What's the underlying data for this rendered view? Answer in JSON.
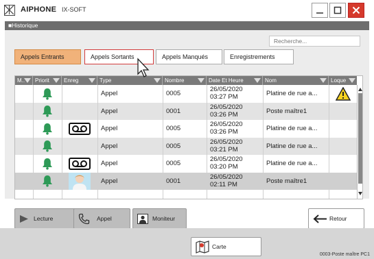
{
  "app": {
    "brand": "AIPHONE",
    "product": "IX-SOFT"
  },
  "section_title": "■Historique",
  "search": {
    "placeholder": "Recherche..."
  },
  "tabs": [
    {
      "label": "Appels Entrants"
    },
    {
      "label": "Appels Sortants"
    },
    {
      "label": "Appels Manqués"
    },
    {
      "label": "Enregistrements"
    }
  ],
  "columns": [
    "M..",
    "Priorit",
    "Enreg",
    "Type",
    "Nombre",
    "Date Et Heure",
    "Nom",
    "Loque"
  ],
  "rows": [
    {
      "rec": false,
      "photo": false,
      "type": "Appel",
      "number": "0005",
      "date": "26/05/2020",
      "time": "03:27 PM",
      "name": "Platine de rue a...",
      "lock": true
    },
    {
      "rec": false,
      "photo": false,
      "type": "Appel",
      "number": "0001",
      "date": "26/05/2020",
      "time": "03:26 PM",
      "name": "Poste maître1",
      "lock": false
    },
    {
      "rec": true,
      "photo": false,
      "type": "Appel",
      "number": "0005",
      "date": "26/05/2020",
      "time": "03:26 PM",
      "name": "Platine de rue a...",
      "lock": false
    },
    {
      "rec": false,
      "photo": false,
      "type": "Appel",
      "number": "0005",
      "date": "26/05/2020",
      "time": "03:21 PM",
      "name": "Platine de rue a...",
      "lock": false
    },
    {
      "rec": true,
      "photo": false,
      "type": "Appel",
      "number": "0005",
      "date": "26/05/2020",
      "time": "03:20 PM",
      "name": "Platine de rue a...",
      "lock": false
    },
    {
      "rec": false,
      "photo": true,
      "type": "Appel",
      "number": "0001",
      "date": "26/05/2020",
      "time": "02:11 PM",
      "name": "Poste maître1",
      "lock": false
    }
  ],
  "buttons": {
    "lecture": "Lecture",
    "appel": "Appel",
    "moniteur": "Moniteur",
    "retour": "Retour",
    "carte": "Carte"
  },
  "status": "0003-Poste maître PC1",
  "colors": {
    "accent_tab": "#f1b27a",
    "bell": "#2e9a57",
    "close": "#d53a2c",
    "header": "#7a7a7a"
  }
}
